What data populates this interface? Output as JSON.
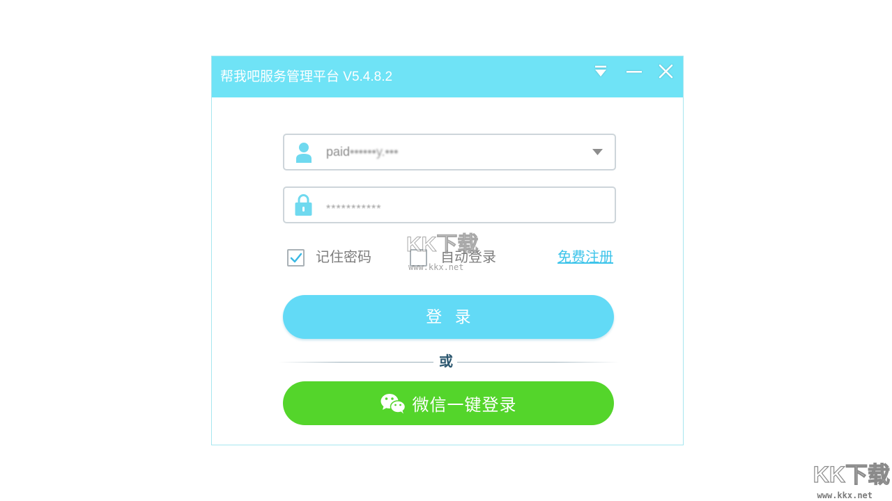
{
  "window": {
    "title": "帮我吧服务管理平台 V5.4.8.2",
    "controls": {
      "menu_icon": "dropdown-menu-icon",
      "minimize_icon": "minimize-icon",
      "close_icon": "close-icon"
    }
  },
  "login_form": {
    "username": {
      "icon": "user-icon",
      "value_visible": "paid",
      "value_obscured": "••••••y.•••",
      "dropdown_icon": "chevron-down-icon"
    },
    "password": {
      "icon": "lock-icon",
      "value": "***********"
    },
    "remember_password": {
      "label": "记住密码",
      "checked": true
    },
    "auto_login": {
      "label": "自动登录",
      "checked": false
    },
    "register_link": "免费注册",
    "login_button": "登 录",
    "divider_text": "或",
    "wechat_login": {
      "icon": "wechat-icon",
      "label": "微信一键登录"
    }
  },
  "watermark": {
    "logo": "KK下载",
    "url": "www.kkx.net"
  },
  "colors": {
    "title_bar": "#6fe3f6",
    "primary_button": "#62daf6",
    "wechat_button": "#54d52b",
    "link": "#3ec4ea",
    "icon": "#6fd9ef",
    "check": "#3bb9e4"
  }
}
